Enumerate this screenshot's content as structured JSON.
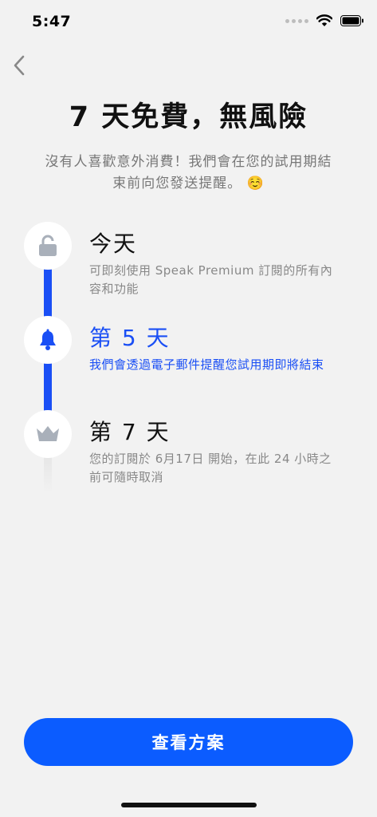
{
  "status_bar": {
    "time": "5:47"
  },
  "header": {
    "title": "7 天免費，無風險",
    "subtitle": "沒有人喜歡意外消費！我們會在您的試用期結束前向您發送提醒。 ☺️"
  },
  "timeline": {
    "steps": [
      {
        "title": "今天",
        "description": "可即刻使用 Speak Premium 訂閱的所有內容和功能",
        "icon": "unlock-icon"
      },
      {
        "title": "第 5 天",
        "description": "我們會透過電子郵件提醒您試用期即將結束",
        "icon": "bell-icon"
      },
      {
        "title": "第 7 天",
        "description": "您的訂閱於 6月17日 開始，在此 24 小時之前可隨時取消",
        "icon": "crown-icon"
      }
    ]
  },
  "cta": {
    "label": "查看方案"
  },
  "colors": {
    "accent": "#1a4ff5",
    "button": "#0b5cff",
    "background": "#f2f2f2",
    "icon_gray": "#a9b0ba"
  }
}
